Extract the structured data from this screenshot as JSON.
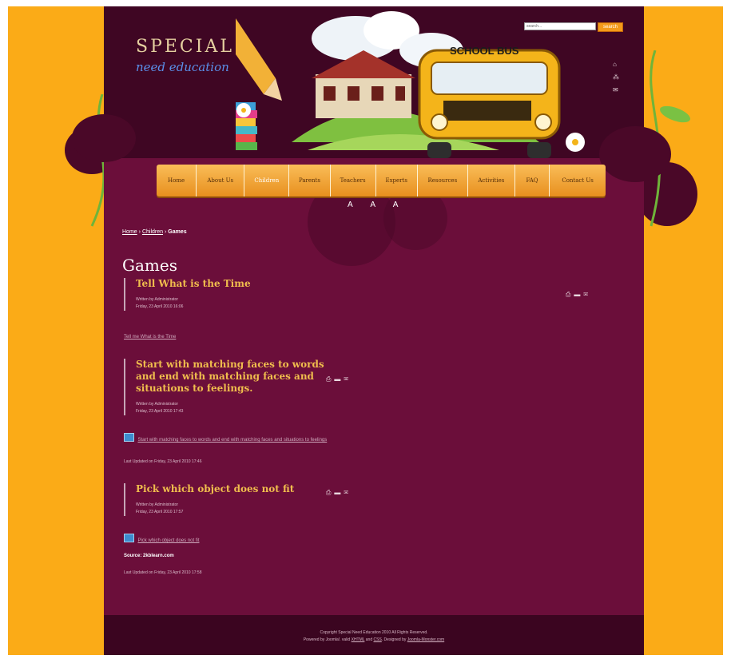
{
  "colors": {
    "page_bg": "#fbab17",
    "site_bg": "#6b0e3a",
    "header_bg": "#3f0623",
    "nav_gradient_top": "#f9bd58",
    "nav_gradient_bottom": "#e88f1e",
    "title_color": "#f0bd4d"
  },
  "header": {
    "logo_line1": "SPECIAL",
    "logo_line2": "need education",
    "search": {
      "placeholder": "search...",
      "button": "search"
    },
    "bus_text": "SCHOOL BUS",
    "util_icons": [
      "home-icon",
      "sitemap-icon",
      "contact-icon"
    ]
  },
  "nav": {
    "items": [
      "Home",
      "About Us",
      "Children",
      "Parents",
      "Teachers",
      "Experts",
      "Resources",
      "Activities",
      "FAQ",
      "Contact Us"
    ],
    "active": "Children"
  },
  "breadcrumb": {
    "home": "Home",
    "parent": "Children",
    "current": "Games",
    "separator": "›"
  },
  "page_title": "Games",
  "articles": [
    {
      "title": "Tell What is the Time",
      "author": "Written by Administrator",
      "date": "Friday, 23 April 2010 16:06",
      "link": "Tell me What is the Time",
      "icons": [
        "pdf-icon",
        "print-icon",
        "email-icon"
      ]
    },
    {
      "title": "Start with matching faces to words and end with matching faces and situations to feelings.",
      "author": "Written by Administrator",
      "date": "Friday, 23 April 2010 17:43",
      "link": "Start with matching faces to words and end with matching faces and situations to feelings",
      "updated": "Last Updated on Friday, 23 April 2010 17:46",
      "icons": [
        "pdf-icon",
        "print-icon",
        "email-icon"
      ]
    },
    {
      "title": "Pick which object does not fit",
      "author": "Written by Administrator",
      "date": "Friday, 23 April 2010 17:57",
      "link": "Pick which object does not fit",
      "source": "Source: 2kblearn.com",
      "updated": "Last Updated on Friday, 23 April 2010 17:58",
      "icons": [
        "pdf-icon",
        "print-icon",
        "email-icon"
      ]
    }
  ],
  "footer": {
    "copyright": "Copyright Special Need Education 2010 All Rights Reserved.",
    "powered_prefix": "Powered by Joomla!. valid ",
    "xhtml": "XHTML",
    "and": " and ",
    "css": "CSS",
    "designed": ". Designed by ",
    "designer": "Joomla-Monster.com"
  }
}
